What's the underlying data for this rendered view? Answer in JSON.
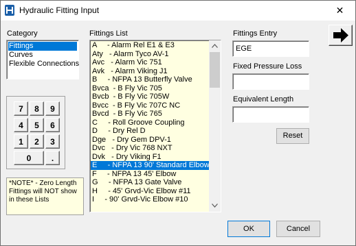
{
  "window": {
    "title": "Hydraulic Fitting Input",
    "close_glyph": "✕"
  },
  "category": {
    "label": "Category",
    "items": [
      "Fittings",
      "Curves",
      "Flexible Connections"
    ],
    "selected_index": 0
  },
  "keypad": {
    "keys": [
      "7",
      "8",
      "9",
      "4",
      "5",
      "6",
      "1",
      "2",
      "3",
      "0",
      "."
    ]
  },
  "note": "*NOTE* - Zero Length Fittings will NOT show in these Lists",
  "fittings": {
    "label": "Fittings List",
    "selected_index": 14,
    "items": [
      "A     - Alarm Rel E1 & E3",
      "Aty   - Alarm Tyco AV-1",
      "Avc   - Alarm Vic 751",
      "Avk   - Alarm Viking J1",
      "B     - NFPA 13 Butterfly Valve",
      "Bvca  - B Fly Vic 705",
      "Bvcb  - B Fly Vic 705W",
      "Bvcc  - B Fly Vic 707C NC",
      "Bvcd  - B Fly Vic 765",
      "C     - Roll Groove Coupling",
      "D     - Dry Rel D",
      "Dge   - Dry Gem DPV-1",
      "Dvc   - Dry Vic 768 NXT",
      "Dvk   - Dry Viking F1",
      "E     - NFPA 13 90' Standard Elbow",
      "F     - NFPA 13 45' Elbow",
      "G     - NFPA 13 Gate Valve",
      "H     - 45' Grvd-Vic Elbow #11",
      "I     - 90' Grvd-Vic Elbow #10"
    ]
  },
  "fittings_entry": {
    "label": "Fittings Entry",
    "value": "EGE"
  },
  "fixed_pressure_loss": {
    "label": "Fixed Pressure Loss",
    "value": ""
  },
  "equivalent_length": {
    "label": "Equivalent Length",
    "value": ""
  },
  "buttons": {
    "reset": "Reset",
    "ok": "OK",
    "cancel": "Cancel"
  },
  "icons": {
    "app": "app-icon",
    "next": "arrow-right-icon",
    "scroll_up": "scroll-up-icon",
    "scroll_down": "scroll-down-icon"
  },
  "colors": {
    "selection": "#0078d7",
    "list_bg": "#ffffe1",
    "window_bg": "#f0f0f0"
  }
}
